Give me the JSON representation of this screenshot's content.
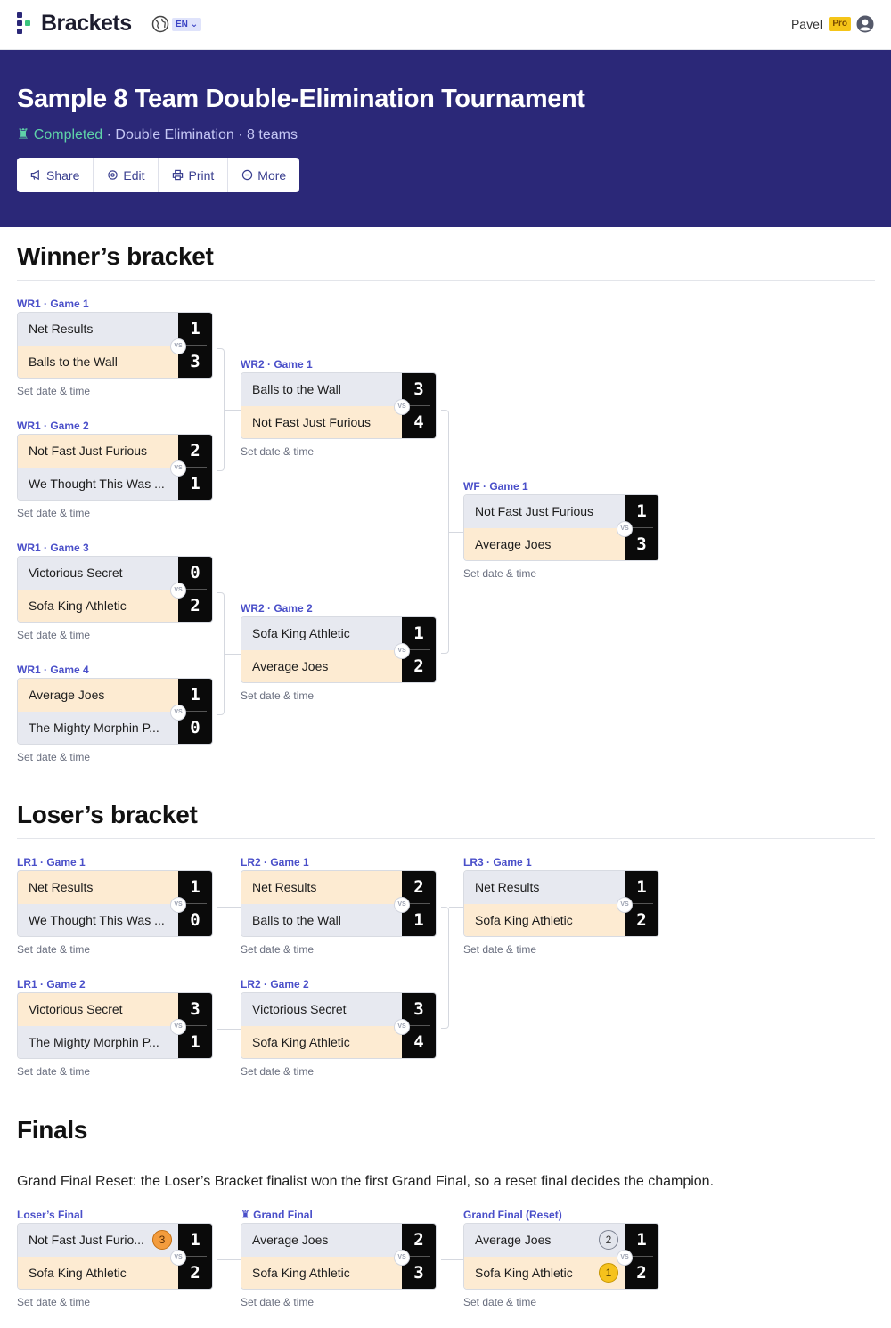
{
  "app": {
    "brand": "Brackets",
    "language": "EN",
    "user": "Pavel",
    "plan": "Pro"
  },
  "tournament": {
    "title": "Sample 8 Team Double-Elimination Tournament",
    "status": "Completed",
    "format": "Double Elimination",
    "teams": "8 teams",
    "sep": "·"
  },
  "actions": [
    "Share",
    "Edit",
    "Print",
    "More"
  ],
  "sections": {
    "winners": "Winner’s bracket",
    "losers": "Loser’s bracket",
    "finals": "Finals",
    "finals_note": "Grand Final Reset: the Loser’s Bracket finalist won the first Grand Final, so a reset final decides the champion."
  },
  "vs": "VS",
  "date_placeholder": "Set date & time",
  "matches": [
    {
      "label": "WR1 · Game 1",
      "t1": "Net Results",
      "s1": "1",
      "t2": "Balls to the Wall",
      "s2": "3",
      "winner": 2
    },
    {
      "label": "WR1 · Game 2",
      "t1": "Not Fast Just Furious",
      "s1": "2",
      "t2": "We Thought This Was ...",
      "s2": "1",
      "winner": 1
    },
    {
      "label": "WR1 · Game 3",
      "t1": "Victorious Secret",
      "s1": "0",
      "t2": "Sofa King Athletic",
      "s2": "2",
      "winner": 2
    },
    {
      "label": "WR1 · Game 4",
      "t1": "Average Joes",
      "s1": "1",
      "t2": "The Mighty Morphin P...",
      "s2": "0",
      "winner": 1
    },
    {
      "label": "WR2 · Game 1",
      "t1": "Balls to the Wall",
      "s1": "3",
      "t2": "Not Fast Just Furious",
      "s2": "4",
      "winner": 2
    },
    {
      "label": "WR2 · Game 2",
      "t1": "Sofa King Athletic",
      "s1": "1",
      "t2": "Average Joes",
      "s2": "2",
      "winner": 2
    },
    {
      "label": "WF · Game 1",
      "t1": "Not Fast Just Furious",
      "s1": "1",
      "t2": "Average Joes",
      "s2": "3",
      "winner": 2
    },
    {
      "label": "LR1 · Game 1",
      "t1": "Net Results",
      "s1": "1",
      "t2": "We Thought This Was ...",
      "s2": "0",
      "winner": 1
    },
    {
      "label": "LR1 · Game 2",
      "t1": "Victorious Secret",
      "s1": "3",
      "t2": "The Mighty Morphin P...",
      "s2": "1",
      "winner": 1
    },
    {
      "label": "LR2 · Game 1",
      "t1": "Net Results",
      "s1": "2",
      "t2": "Balls to the Wall",
      "s2": "1",
      "winner": 1
    },
    {
      "label": "LR2 · Game 2",
      "t1": "Victorious Secret",
      "s1": "3",
      "t2": "Sofa King Athletic",
      "s2": "4",
      "winner": 2
    },
    {
      "label": "LR3 · Game 1",
      "t1": "Net Results",
      "s1": "1",
      "t2": "Sofa King Athletic",
      "s2": "2",
      "winner": 2
    },
    {
      "label": "Loser’s Final",
      "t1": "Not Fast Just Furio...",
      "s1": "1",
      "t2": "Sofa King Athletic",
      "s2": "2",
      "winner": 2,
      "badge1": "3"
    },
    {
      "label": "Grand Final",
      "t1": "Average Joes",
      "s1": "2",
      "t2": "Sofa King Athletic",
      "s2": "3",
      "winner": 2
    },
    {
      "label": "Grand Final (Reset)",
      "t1": "Average Joes",
      "s1": "1",
      "t2": "Sofa King Athletic",
      "s2": "2",
      "winner": 2,
      "badge1": "2",
      "badge2": "1"
    }
  ],
  "colors": {
    "hero": "#2b2878",
    "accent": "#4a4fc9",
    "winner_row": "#fdebd2",
    "loser_row": "#e7e9f0",
    "completed": "#5fd3a8"
  }
}
